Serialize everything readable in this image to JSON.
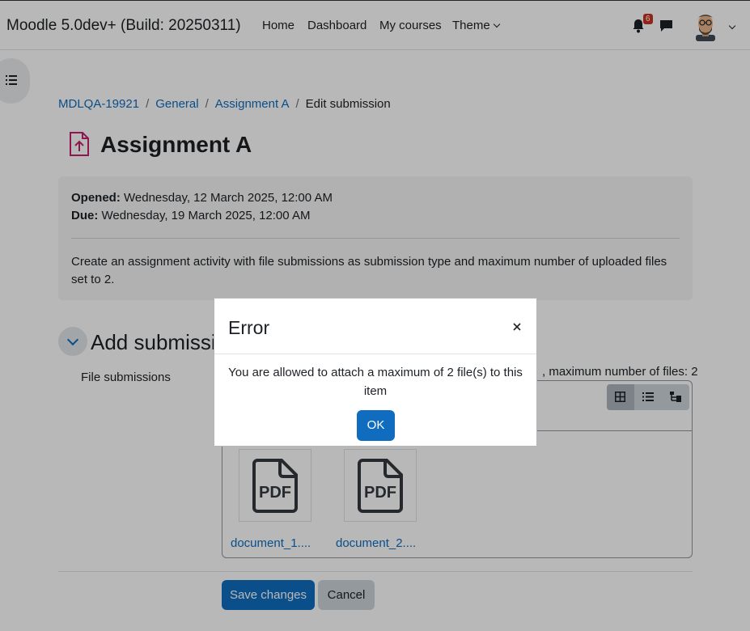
{
  "navbar": {
    "brand": "Moodle 5.0dev+ (Build: 20250311)",
    "links": [
      "Home",
      "Dashboard",
      "My courses",
      "Theme"
    ],
    "notification_count": "6"
  },
  "breadcrumb": {
    "items": [
      "MDLQA-19921",
      "General",
      "Assignment A"
    ],
    "current": "Edit submission"
  },
  "page": {
    "title": "Assignment A"
  },
  "dates": {
    "opened_label": "Opened:",
    "opened_value": " Wednesday, 12 March 2025, 12:00 AM",
    "due_label": "Due:",
    "due_value": " Wednesday, 19 March 2025, 12:00 AM"
  },
  "intro": "Create an assignment activity with file submissions as submission type and maximum number of uploaded files set to 2.",
  "submission": {
    "section_title": "Add submission",
    "field_label": "File submissions",
    "limits_text": ", maximum number of files: 2",
    "files": [
      "document_1....",
      "document_2...."
    ],
    "file_icon": "pdf-file-icon"
  },
  "buttons": {
    "save": "Save changes",
    "cancel": "Cancel"
  },
  "modal": {
    "title": "Error",
    "message": "You are allowed to attach a maximum of 2 file(s) to this item",
    "ok": "OK"
  },
  "colors": {
    "primary": "#0f6cbf",
    "badge": "#ca3120",
    "activity_icon": "#c4206d"
  }
}
